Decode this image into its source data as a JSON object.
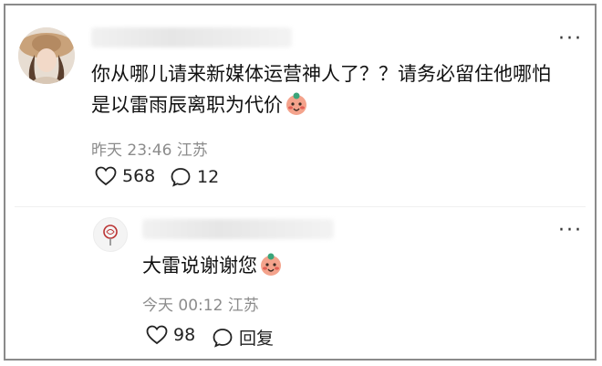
{
  "top_comment": {
    "text_line1": "你从哪儿请来新媒体运营神人了？？请务必留住他哪怕",
    "text_line2": "是以雷雨辰离职为代价",
    "emoji": "blushing-face-icon",
    "time": "昨天 23:46",
    "location": "江苏",
    "likes": "568",
    "comments": "12",
    "more_label": "···"
  },
  "reply": {
    "text": "大雷说谢谢您",
    "emoji": "blushing-face-icon",
    "time": "今天 00:12",
    "location": "江苏",
    "likes": "98",
    "reply_label": "回复",
    "more_label": "···"
  },
  "colors": {
    "meta_text": "#8c8c8c",
    "frame_border": "#8a8a8a",
    "emoji_face": "#f4a38c"
  }
}
